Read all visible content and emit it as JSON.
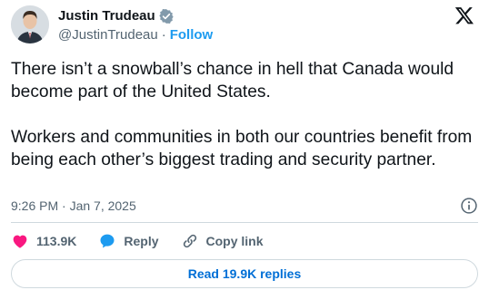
{
  "author": {
    "display_name": "Justin Trudeau",
    "handle": "@JustinTrudeau",
    "separator": "·",
    "follow_label": "Follow",
    "verified_color": "#829aab"
  },
  "tweet": {
    "text": "There isn’t a snowball’s chance in hell that Canada would become part of the United States.\n\nWorkers and communities in both our countries benefit from being each other’s biggest trading and security partner.",
    "timestamp": "9:26 PM · Jan 7, 2025"
  },
  "actions": {
    "likes_count": "113.9K",
    "reply_label": "Reply",
    "copy_link_label": "Copy link"
  },
  "replies_button": {
    "label": "Read 19.9K replies"
  },
  "icons": {
    "brand": "x-logo-icon",
    "info": "info-icon",
    "like": "heart-icon",
    "reply": "speech-bubble-icon",
    "copy": "link-icon"
  },
  "colors": {
    "accent": "#1d9bf0",
    "like": "#f91880",
    "muted": "#536471",
    "text": "#0f1419"
  }
}
